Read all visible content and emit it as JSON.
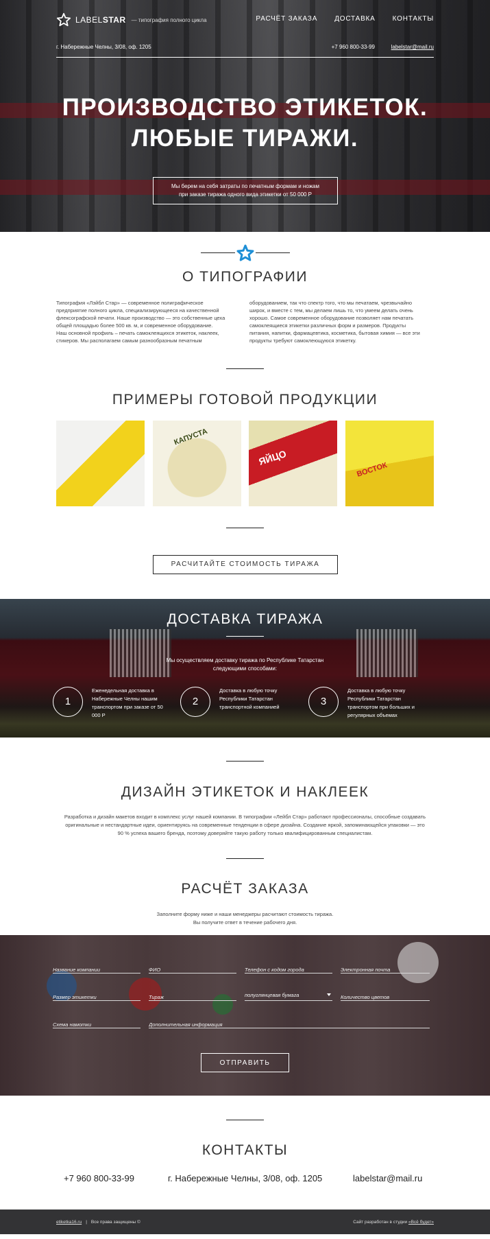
{
  "header": {
    "brand_light": "LABEL",
    "brand_bold": "STAR",
    "slogan": "— типография полного цикла",
    "nav": [
      "РАСЧЁТ ЗАКАЗА",
      "ДОСТАВКА",
      "КОНТАКТЫ"
    ],
    "address": "г. Набережные Челны, 3/08, оф. 1205",
    "phone": "+7 960 800-33-99",
    "email": "labelstar@mail.ru"
  },
  "hero": {
    "title_line1": "ПРОИЗВОДСТВО ЭТИКЕТОК.",
    "title_line2": "ЛЮБЫЕ ТИРАЖИ.",
    "note_line1": "Мы берем на себя затраты по печатным формам и ножам",
    "note_line2": "при заказе тиража одного вида этикетки от 50 000 Р"
  },
  "about": {
    "title": "О ТИПОГРАФИИ",
    "col1": "Типография «Лэйбл Стар» — современное полиграфическое предприятие полного цикла, специализирующееся на качественной флексографской печати. Наше производство — это собственные цеха общей площадью более 500 кв. м, и современное оборудование.\nНаш основной профиль – печать самоклеящихся этикеток, наклеек, стикеров. Мы располагаем самым разнообразным печатным",
    "col2": "оборудованием, так что спектр того, что мы печатаем, чрезвычайно широк, и вместе с тем, мы делаем лишь то, что умеем делать очень хорошо. Самое современное оборудование позволяет нам печатать самоклеящиеся этикетки различных форм и размеров. Продукты питания, напитки, фармацевтика, косметика, бытовая химия — все эти продукты требуют самоклеющуюся этикетку."
  },
  "products": {
    "title": "ПРИМЕРЫ ГОТОВОЙ ПРОДУКЦИИ",
    "items": [
      "",
      "КАПУСТА",
      "ЯЙЦО",
      "ВОСТОК"
    ],
    "button": "РАСЧИТАЙТЕ СТОИМОСТЬ ТИРАЖА"
  },
  "delivery": {
    "title": "ДОСТАВКА ТИРАЖА",
    "intro_line1": "Мы осуществляем доставку тиража по Республике Татарстан",
    "intro_line2": "следующими способами:",
    "steps": [
      {
        "num": "1",
        "text": "Еженедельная доставка в Набережные Челны нашим транспортом при заказе от 50 000 Р"
      },
      {
        "num": "2",
        "text": "Доставка в любую точку Республики Татарстан транспортной компанией"
      },
      {
        "num": "3",
        "text": "Доставка в любую точку Республики Татарстан транспортом при больших и регулярных объемах"
      }
    ]
  },
  "design": {
    "title": "ДИЗАЙН ЭТИКЕТОК И НАКЛЕЕК",
    "text": "Разработка и дизайн макетов входит в комплекс услуг нашей компании. В типографии «Лейбл Стар» работают профессионалы, способные создавать оригинальные и нестандартные идеи, ориентируясь на современные тенденции в сфере дизайна. Создание яркой, запоминающейся упаковки — это 90 % успеха вашего бренда, поэтому доверяйте такую работу только квалифицированным специалистам."
  },
  "calc": {
    "title": "РАСЧЁТ ЗАКАЗА",
    "text_line1": "Заполните форму ниже и наши менеджеры расчитают стоимость тиража.",
    "text_line2": "Вы получите ответ в течение рабочего дня."
  },
  "form": {
    "company": "Название компании",
    "fio": "ФИО",
    "phone": "Телефон с кодом города",
    "email": "Электронная почта",
    "size": "Размер этикетки",
    "run": "Тираж",
    "paper": "полуглянцевая бумага",
    "colors": "Количество цветов",
    "winding": "Схема намотки",
    "extra": "Дополнительная информация",
    "submit": "ОТПРАВИТЬ"
  },
  "contacts": {
    "title": "КОНТАКТЫ",
    "phone": "+7 960 800-33-99",
    "address": "г. Набережные Челны, 3/08, оф. 1205",
    "email": "labelstar@mail.ru"
  },
  "footer": {
    "site": "etiketka16.ru",
    "rights": "Все права защищены ©",
    "dev_prefix": "Сайт разработан в студии ",
    "dev_link": "«Всё будет»"
  },
  "colors": {
    "accent_star": "#1e8fd6",
    "footer_bg": "#333335"
  }
}
